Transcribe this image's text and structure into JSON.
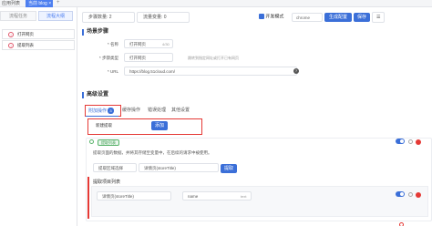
{
  "topbar": {
    "title": "应用列表",
    "tab_label": "当前 blog",
    "close": "×",
    "add": "+"
  },
  "sidebar": {
    "tab_a": "流程任务",
    "tab_b": "流程大纲",
    "items": [
      {
        "label": "打开网页",
        "icon": "!"
      },
      {
        "label": "提取列表",
        "icon": "!"
      }
    ]
  },
  "toolbar": {
    "steps_label": "步骤数量: 2",
    "vars_label": "流量变量: 0",
    "mode_label": "开发模式",
    "browser_value": "chrome",
    "generate_label": "生成配置",
    "save_label": "保存",
    "more": "☰"
  },
  "step": {
    "title": "场景步骤",
    "name_label": "* 名称",
    "name_value": "打开网页",
    "name_count": "4/30",
    "type_label": "* 步骤类型",
    "type_value": "打开网页",
    "type_hint": "跳转到指定网址或打开已有网页",
    "url_label": "* URL",
    "url_value": "https://blog.51cloud.com/"
  },
  "advanced": {
    "title": "高级设置",
    "tabs": [
      {
        "label": "附加操作",
        "badge": "3"
      },
      {
        "label": "缓存操作"
      },
      {
        "label": "错误处理"
      },
      {
        "label": "其他设置"
      }
    ],
    "add_input_placeholder": "新建提取",
    "add_button": "添加",
    "rule": {
      "badge": "提取列表",
      "desc": "提取页面的数据，并将其存储至变量中，在后续的请求中被使用。",
      "field_a_placeholder": "提取区域选择",
      "field_b_placeholder": "详情页(storeTitle)",
      "extract_button": "提取",
      "sub_title": "提取项目列表",
      "sub_field_value": "详情页(storeTitle)",
      "sub_name_value": "name",
      "sub_count": "text"
    }
  }
}
